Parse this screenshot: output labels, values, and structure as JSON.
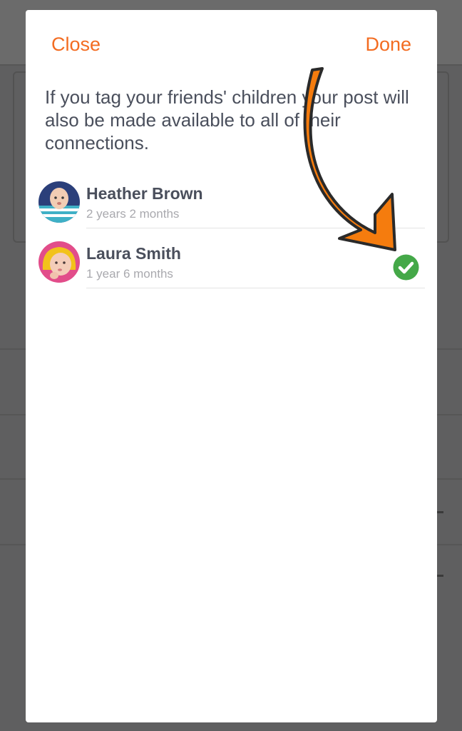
{
  "header": {
    "close_label": "Close",
    "done_label": "Done"
  },
  "intro_text": "If you tag your friends' children your post will also be made available to all of their connections.",
  "children": [
    {
      "name": "Heather Brown",
      "age": "2 years 2 months",
      "selected": false
    },
    {
      "name": "Laura Smith",
      "age": "1 year 6 months",
      "selected": true
    }
  ],
  "colors": {
    "accent": "#f36c21",
    "check": "#44a848",
    "overlay": "#5f5f60",
    "arrow": "#f57c0e"
  },
  "icons": {
    "selected": "check-circle-icon",
    "annotation": "curved-arrow-icon"
  }
}
